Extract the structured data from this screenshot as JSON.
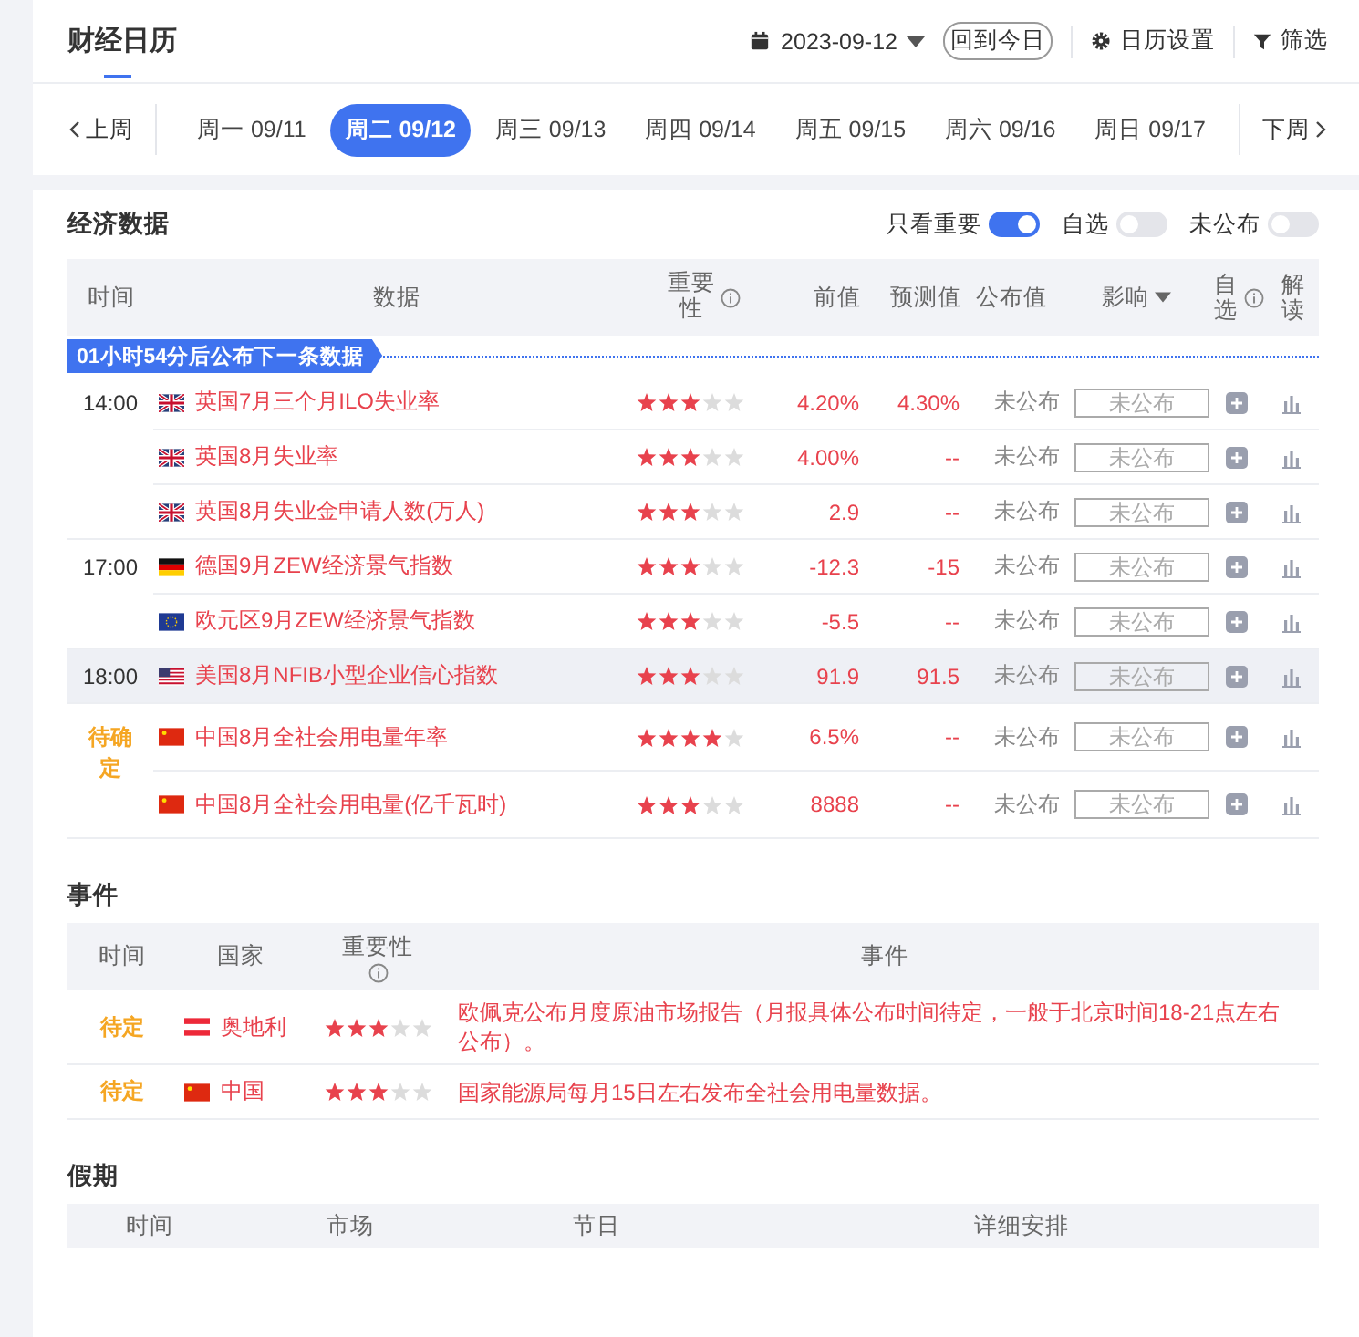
{
  "header": {
    "title": "财经日历",
    "date": "2023-09-12",
    "today_button": "回到今日",
    "settings": "日历设置",
    "filter": "筛选"
  },
  "week_nav": {
    "prev": "上周",
    "next": "下周",
    "days": [
      {
        "label": "周一 09/11",
        "selected": false
      },
      {
        "label": "周二 09/12",
        "selected": true
      },
      {
        "label": "周三 09/13",
        "selected": false
      },
      {
        "label": "周四 09/14",
        "selected": false
      },
      {
        "label": "周五 09/15",
        "selected": false
      },
      {
        "label": "周六 09/16",
        "selected": false
      },
      {
        "label": "周日 09/17",
        "selected": false
      }
    ]
  },
  "economic": {
    "title": "经济数据",
    "toggles": [
      {
        "label": "只看重要",
        "on": true
      },
      {
        "label": "自选",
        "on": false
      },
      {
        "label": "未公布",
        "on": false
      }
    ],
    "columns": [
      {
        "label": "时间"
      },
      {
        "label": "数据"
      },
      {
        "label": "重要性"
      },
      {
        "label": "前值"
      },
      {
        "label": "预测值"
      },
      {
        "label": "公布值"
      },
      {
        "label": "影响"
      },
      {
        "label": "自选"
      },
      {
        "label": "解读"
      }
    ],
    "countdown": "01小时54分后公布下一条数据",
    "groups": [
      {
        "time": "14:00",
        "pending": false,
        "highlighted": false,
        "rows": [
          {
            "kind": "uk",
            "name": "英国7月三个月ILO失业率",
            "stars": 3,
            "previous": "4.20%",
            "forecast": "4.30%",
            "actual": "未公布",
            "impact": "未公布"
          },
          {
            "kind": "uk",
            "name": "英国8月失业率",
            "stars": 3,
            "previous": "4.00%",
            "forecast": "--",
            "actual": "未公布",
            "impact": "未公布"
          },
          {
            "kind": "uk",
            "name": "英国8月失业金申请人数(万人)",
            "stars": 3,
            "previous": "2.9",
            "forecast": "--",
            "actual": "未公布",
            "impact": "未公布"
          }
        ]
      },
      {
        "time": "17:00",
        "pending": false,
        "highlighted": false,
        "rows": [
          {
            "kind": "de",
            "name": "德国9月ZEW经济景气指数",
            "stars": 3,
            "previous": "-12.3",
            "forecast": "-15",
            "actual": "未公布",
            "impact": "未公布"
          },
          {
            "kind": "eu",
            "name": "欧元区9月ZEW经济景气指数",
            "stars": 3,
            "previous": "-5.5",
            "forecast": "--",
            "actual": "未公布",
            "impact": "未公布"
          }
        ]
      },
      {
        "time": "18:00",
        "pending": false,
        "highlighted": true,
        "rows": [
          {
            "kind": "us",
            "name": "美国8月NFIB小型企业信心指数",
            "stars": 3,
            "previous": "91.9",
            "forecast": "91.5",
            "actual": "未公布",
            "impact": "未公布"
          }
        ]
      },
      {
        "time": "待确定",
        "pending": true,
        "highlighted": false,
        "rows": [
          {
            "kind": "cn",
            "name": "中国8月全社会用电量年率",
            "stars": 4,
            "previous": "6.5%",
            "forecast": "--",
            "actual": "未公布",
            "impact": "未公布"
          },
          {
            "kind": "cn",
            "name": "中国8月全社会用电量(亿千瓦时)",
            "stars": 3,
            "previous": "8888",
            "forecast": "--",
            "actual": "未公布",
            "impact": "未公布"
          }
        ]
      }
    ]
  },
  "events": {
    "title": "事件",
    "columns": [
      {
        "label": "时间"
      },
      {
        "label": "国家"
      },
      {
        "label": "重要性"
      },
      {
        "label": "事件"
      }
    ],
    "rows": [
      {
        "time": "待定",
        "kind": "at",
        "country": "奥地利",
        "stars": 3,
        "text": "欧佩克公布月度原油市场报告（月报具体公布时间待定，一般于北京时间18-21点左右公布）。"
      },
      {
        "time": "待定",
        "kind": "cn",
        "country": "中国",
        "stars": 3,
        "text": "国家能源局每月15日左右发布全社会用电量数据。"
      }
    ]
  },
  "holidays": {
    "title": "假期",
    "columns": [
      "时间",
      "市场",
      "节日",
      "详细安排"
    ]
  }
}
